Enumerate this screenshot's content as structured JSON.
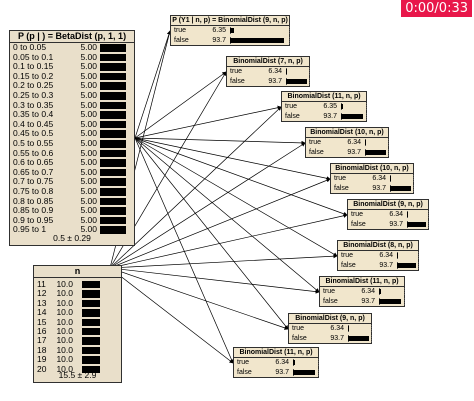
{
  "timer": "0:00/0:33",
  "beta_node": {
    "title": "P (p | ) = BetaDist (p, 1, 1)",
    "rows": [
      {
        "label": "0 to 0.05",
        "value": "5.00",
        "fill": 0.05
      },
      {
        "label": "0.05 to 0.1",
        "value": "5.00",
        "fill": 0.05
      },
      {
        "label": "0.1 to 0.15",
        "value": "5.00",
        "fill": 0.05
      },
      {
        "label": "0.15 to 0.2",
        "value": "5.00",
        "fill": 0.05
      },
      {
        "label": "0.2 to 0.25",
        "value": "5.00",
        "fill": 0.05
      },
      {
        "label": "0.25 to 0.3",
        "value": "5.00",
        "fill": 0.05
      },
      {
        "label": "0.3 to 0.35",
        "value": "5.00",
        "fill": 0.05
      },
      {
        "label": "0.35 to 0.4",
        "value": "5.00",
        "fill": 0.05
      },
      {
        "label": "0.4 to 0.45",
        "value": "5.00",
        "fill": 0.05
      },
      {
        "label": "0.45 to 0.5",
        "value": "5.00",
        "fill": 0.05
      },
      {
        "label": "0.5 to 0.55",
        "value": "5.00",
        "fill": 0.05
      },
      {
        "label": "0.55 to 0.6",
        "value": "5.00",
        "fill": 0.05
      },
      {
        "label": "0.6 to 0.65",
        "value": "5.00",
        "fill": 0.05
      },
      {
        "label": "0.65 to 0.7",
        "value": "5.00",
        "fill": 0.05
      },
      {
        "label": "0.7 to 0.75",
        "value": "5.00",
        "fill": 0.05
      },
      {
        "label": "0.75 to 0.8",
        "value": "5.00",
        "fill": 0.05
      },
      {
        "label": "0.8 to 0.85",
        "value": "5.00",
        "fill": 0.05
      },
      {
        "label": "0.85 to 0.9",
        "value": "5.00",
        "fill": 0.05
      },
      {
        "label": "0.9 to 0.95",
        "value": "5.00",
        "fill": 0.05
      },
      {
        "label": "0.95 to 1",
        "value": "5.00",
        "fill": 0.05
      }
    ],
    "summary": "0.5 ± 0.29"
  },
  "n_node": {
    "title": "n",
    "rows": [
      {
        "label": "11",
        "value": "10.0",
        "fill": 0.1
      },
      {
        "label": "12",
        "value": "10.0",
        "fill": 0.1
      },
      {
        "label": "13",
        "value": "10.0",
        "fill": 0.1
      },
      {
        "label": "14",
        "value": "10.0",
        "fill": 0.1
      },
      {
        "label": "15",
        "value": "10.0",
        "fill": 0.1
      },
      {
        "label": "16",
        "value": "10.0",
        "fill": 0.1
      },
      {
        "label": "17",
        "value": "10.0",
        "fill": 0.1
      },
      {
        "label": "18",
        "value": "10.0",
        "fill": 0.1
      },
      {
        "label": "19",
        "value": "10.0",
        "fill": 0.1
      },
      {
        "label": "20",
        "value": "10.0",
        "fill": 0.1
      }
    ],
    "summary": "15.5 ± 2.9"
  },
  "binomial_nodes": [
    {
      "title": "P (Y1 | n, p) = BinomialDist (9, n, p)",
      "true_value": "6.35",
      "false_value": "93.7",
      "true_fill": 0.0635,
      "false_fill": 0.937
    },
    {
      "title": "BinomialDist (7, n, p)",
      "true_value": "6.34",
      "false_value": "93.7",
      "true_fill": 0.0634,
      "false_fill": 0.937
    },
    {
      "title": "BinomialDist (11, n, p)",
      "true_value": "6.35",
      "false_value": "93.7",
      "true_fill": 0.0635,
      "false_fill": 0.937
    },
    {
      "title": "BinomialDist (10, n, p)",
      "true_value": "6.34",
      "false_value": "93.7",
      "true_fill": 0.0634,
      "false_fill": 0.937
    },
    {
      "title": "BinomialDist (10, n, p)",
      "true_value": "6.34",
      "false_value": "93.7",
      "true_fill": 0.0634,
      "false_fill": 0.937
    },
    {
      "title": "BinomialDist (9, n, p)",
      "true_value": "6.34",
      "false_value": "93.7",
      "true_fill": 0.0634,
      "false_fill": 0.937
    },
    {
      "title": "BinomialDist (8, n, p)",
      "true_value": "6.34",
      "false_value": "93.7",
      "true_fill": 0.0634,
      "false_fill": 0.937
    },
    {
      "title": "BinomialDist (11, n, p)",
      "true_value": "6.34",
      "false_value": "93.7",
      "true_fill": 0.0634,
      "false_fill": 0.937
    },
    {
      "title": "BinomialDist (9, n, p)",
      "true_value": "6.34",
      "false_value": "93.7",
      "true_fill": 0.0634,
      "false_fill": 0.937
    },
    {
      "title": "BinomialDist (11, n, p)",
      "true_value": "6.34",
      "false_value": "93.7",
      "true_fill": 0.0634,
      "false_fill": 0.937
    }
  ],
  "state_labels": {
    "true": "true",
    "false": "false"
  },
  "colors": {
    "node_fill": "#f1e6cc",
    "big_node_fill": "#e9dfca",
    "border": "#303030",
    "bar": "#000000",
    "timer_bg": "#e8174a"
  }
}
